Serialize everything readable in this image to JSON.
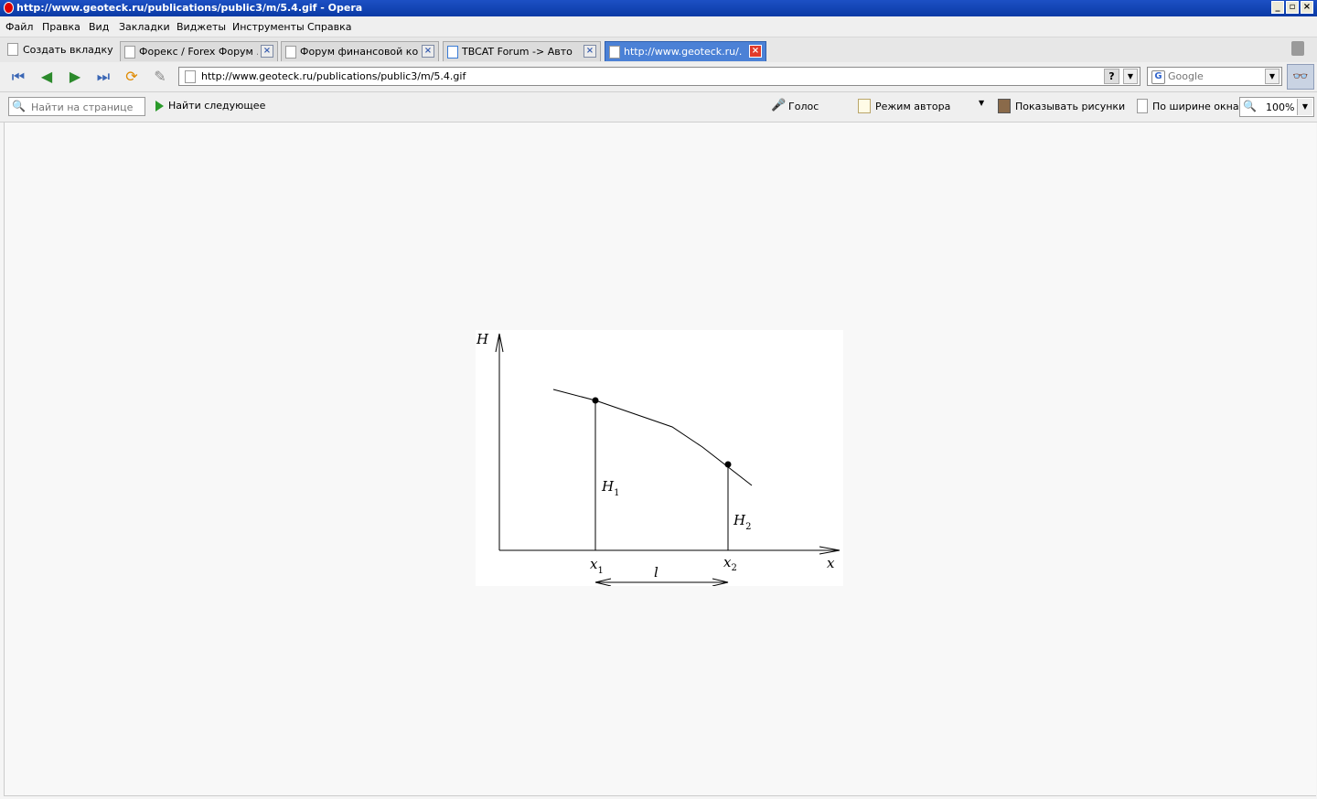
{
  "window": {
    "title": "http://www.geoteck.ru/publications/public3/m/5.4.gif - Opera",
    "controls": [
      "_",
      "▫",
      "×"
    ]
  },
  "menu": [
    "Файл",
    "Правка",
    "Вид",
    "Закладки",
    "Виджеты",
    "Инструменты",
    "Справка"
  ],
  "tabs": {
    "new_tab_label": "Создать вкладку",
    "items": [
      {
        "label": "Форекс / Forex Форум ...",
        "active": false
      },
      {
        "label": "Форум финансовой ком...",
        "active": false
      },
      {
        "label": "TBCAT Forum -> Авто",
        "active": false
      },
      {
        "label": "http://www.geoteck.ru/...",
        "active": true
      }
    ]
  },
  "address": {
    "url": "http://www.geoteck.ru/publications/public3/m/5.4.gif",
    "help": "?"
  },
  "search": {
    "engine_letter": "G",
    "placeholder": "Google"
  },
  "find": {
    "placeholder": "Найти на странице",
    "next_label": "Найти следующее"
  },
  "toolbar": {
    "voice": "Голос",
    "author_mode": "Режим автора",
    "show_images": "Показывать рисунки",
    "fit_width": "По ширине окна",
    "zoom": "100%"
  },
  "figure": {
    "y_axis": "H",
    "x_axis": "x",
    "h1": "H",
    "h1_sub": "1",
    "h2": "H",
    "h2_sub": "2",
    "x1": "x",
    "x1_sub": "1",
    "x2": "x",
    "x2_sub": "2",
    "length": "l"
  }
}
